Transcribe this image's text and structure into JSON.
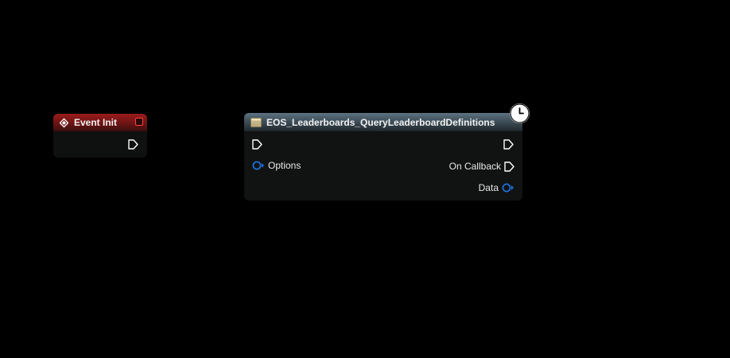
{
  "event_node": {
    "title": "Event Init",
    "header_color": "#8a1a1a",
    "icon": "event-diamond-icon",
    "delegate_pin_color": "#ff4040"
  },
  "function_node": {
    "title": "EOS_Leaderboards_QueryLeaderboardDefinitions",
    "header_color": "#4a5c68",
    "icon": "function-icon",
    "latent_icon": "clock-icon",
    "pins": {
      "exec_in": "exec-in-pin",
      "exec_out": "exec-out-pin",
      "options_label": "Options",
      "on_callback_label": "On Callback",
      "data_label": "Data"
    },
    "struct_pin_color": "#1f6fd6"
  }
}
